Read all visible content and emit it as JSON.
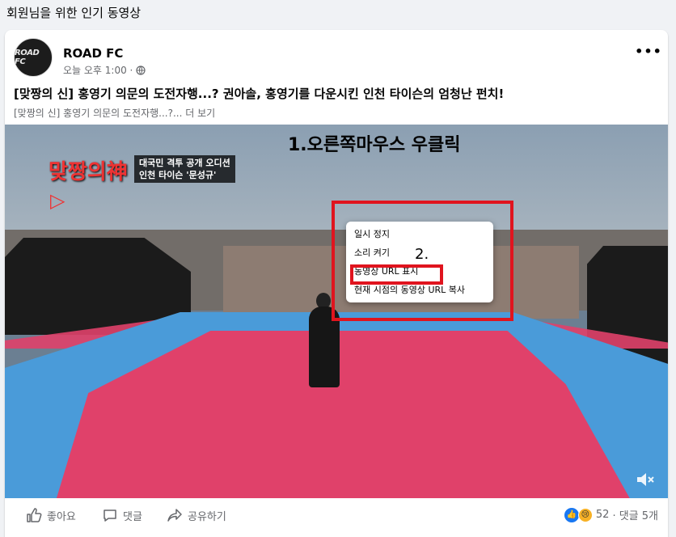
{
  "section": {
    "title": "회원님을 위한 인기 동영상"
  },
  "post": {
    "page_name": "ROAD FC",
    "avatar_text": "ROAD FC",
    "time": "오늘 오후 1:00 ·",
    "more_label": "•••",
    "title": "[맞짱의 신] 홍영기 의문의 도전자행...? 권아솔, 홍영기를 다운시킨 인천 타이슨의 엄청난 펀치!",
    "subtitle": "[맞짱의 신] 홍영기 의문의 도전자행...?... 더 보기"
  },
  "video": {
    "logo_text": "맞짱의神",
    "logo_subtitle": [
      "대국민 격투 공개 오디션",
      "인천 타이슨 '문성규'"
    ],
    "logo_play": "▷",
    "annotation_1": "1.오른쪽마우스 우클릭",
    "annotation_2": "2.",
    "context_menu": {
      "items": [
        "일시 정지",
        "소리 켜기",
        "동영상 URL 표시",
        "현재 시점의 동영상 URL 복사"
      ]
    },
    "muted_icon": "volume-muted-icon"
  },
  "actions": {
    "like": "좋아요",
    "comment": "댓글",
    "share": "공유하기"
  },
  "reactions": {
    "count": "52",
    "comments": "· 댓글 5개"
  },
  "colors": {
    "annotation_red": "#e0141e",
    "facebook_blue": "#1877f2",
    "secondary_text": "#65676b"
  }
}
